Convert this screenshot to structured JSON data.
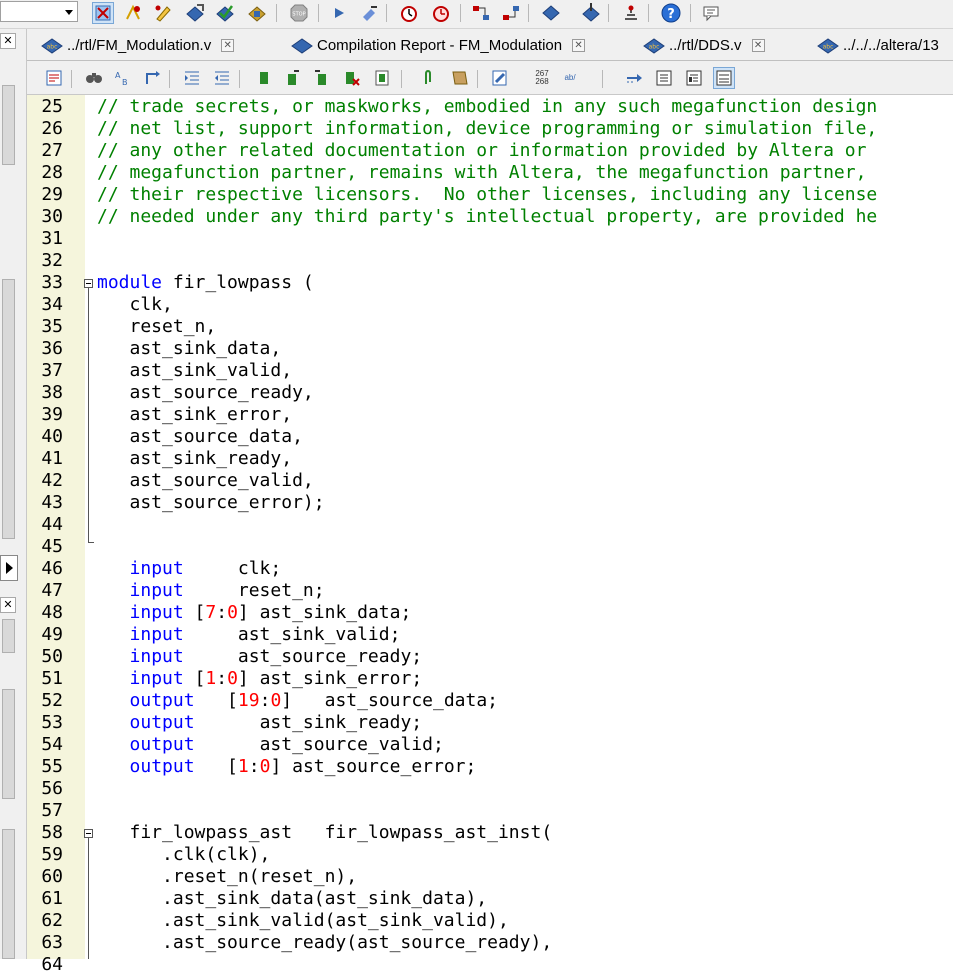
{
  "toolbar": {
    "icons": [
      "chip-planner-icon",
      "pin-planner-icon",
      "edit-icon",
      "compile-icon",
      "analysis-icon",
      "fitter-icon",
      "stop-icon",
      "start-icon",
      "assembler-icon",
      "timing-icon",
      "timequest-icon",
      "netlist-viewer-icon",
      "rtl-viewer-icon",
      "programmer-icon",
      "chip-download-icon",
      "signal-tap-icon",
      "help-icon",
      "comment-icon"
    ]
  },
  "tabs": [
    {
      "label": "../rtl/FM_Modulation.v",
      "icon": "verilog-file-icon"
    },
    {
      "label": "Compilation Report - FM_Modulation",
      "icon": "report-icon"
    },
    {
      "label": "../rtl/DDS.v",
      "icon": "verilog-file-icon"
    },
    {
      "label": "../../../altera/13",
      "icon": "verilog-file-icon"
    }
  ],
  "editor_toolbar": {
    "line_col_label": "267\n268",
    "replace_label": "ab/"
  },
  "editor": {
    "lines": [
      {
        "n": "25",
        "text": "// trade secrets, or maskworks, embodied in any such megafunction design"
      },
      {
        "n": "26",
        "text": "// net list, support information, device programming or simulation file,"
      },
      {
        "n": "27",
        "text": "// any other related documentation or information provided by Altera or"
      },
      {
        "n": "28",
        "text": "// megafunction partner, remains with Altera, the megafunction partner,"
      },
      {
        "n": "29",
        "text": "// their respective licensors.  No other licenses, including any license"
      },
      {
        "n": "30",
        "text": "// needed under any third party's intellectual property, are provided he"
      },
      {
        "n": "31",
        "text": ""
      },
      {
        "n": "32",
        "text": ""
      },
      {
        "n": "33",
        "text": "module fir_lowpass ("
      },
      {
        "n": "34",
        "text": "   clk,"
      },
      {
        "n": "35",
        "text": "   reset_n,"
      },
      {
        "n": "36",
        "text": "   ast_sink_data,"
      },
      {
        "n": "37",
        "text": "   ast_sink_valid,"
      },
      {
        "n": "38",
        "text": "   ast_source_ready,"
      },
      {
        "n": "39",
        "text": "   ast_sink_error,"
      },
      {
        "n": "40",
        "text": "   ast_source_data,"
      },
      {
        "n": "41",
        "text": "   ast_sink_ready,"
      },
      {
        "n": "42",
        "text": "   ast_source_valid,"
      },
      {
        "n": "43",
        "text": "   ast_source_error);"
      },
      {
        "n": "44",
        "text": ""
      },
      {
        "n": "45",
        "text": ""
      },
      {
        "n": "46",
        "text": "   input     clk;"
      },
      {
        "n": "47",
        "text": "   input     reset_n;"
      },
      {
        "n": "48",
        "text": "   input [7:0] ast_sink_data;"
      },
      {
        "n": "49",
        "text": "   input     ast_sink_valid;"
      },
      {
        "n": "50",
        "text": "   input     ast_source_ready;"
      },
      {
        "n": "51",
        "text": "   input [1:0] ast_sink_error;"
      },
      {
        "n": "52",
        "text": "   output   [19:0]   ast_source_data;"
      },
      {
        "n": "53",
        "text": "   output      ast_sink_ready;"
      },
      {
        "n": "54",
        "text": "   output      ast_source_valid;"
      },
      {
        "n": "55",
        "text": "   output   [1:0] ast_source_error;"
      },
      {
        "n": "56",
        "text": ""
      },
      {
        "n": "57",
        "text": ""
      },
      {
        "n": "58",
        "text": "   fir_lowpass_ast   fir_lowpass_ast_inst("
      },
      {
        "n": "59",
        "text": "      .clk(clk),"
      },
      {
        "n": "60",
        "text": "      .reset_n(reset_n),"
      },
      {
        "n": "61",
        "text": "      .ast_sink_data(ast_sink_data),"
      },
      {
        "n": "62",
        "text": "      .ast_sink_valid(ast_sink_valid),"
      },
      {
        "n": "63",
        "text": "      .ast_source_ready(ast_source_ready),"
      },
      {
        "n": "64",
        "text": ""
      }
    ]
  },
  "colors": {
    "comment": "#008000",
    "keyword": "#0000ff",
    "number": "#ff0000",
    "gutter_bg": "#f5f5dc"
  }
}
